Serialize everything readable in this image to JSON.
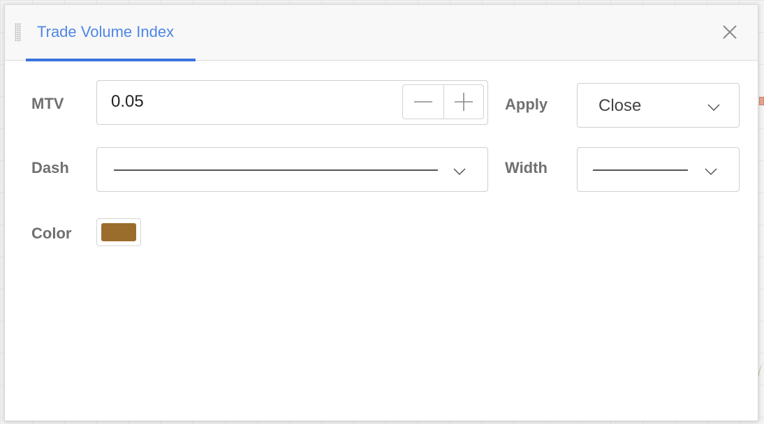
{
  "dialog": {
    "title": "Trade Volume Index",
    "accent_color": "#3b73de",
    "close_icon": "close-icon",
    "drag_icon": "drag-handle-icon"
  },
  "form": {
    "mtv": {
      "label": "MTV",
      "value": "0.05",
      "decrement_icon": "minus-icon",
      "increment_icon": "plus-icon"
    },
    "apply": {
      "label": "Apply",
      "selected": "Close"
    },
    "dash": {
      "label": "Dash",
      "selected_style": "solid"
    },
    "width": {
      "label": "Width",
      "selected_style": "solid"
    },
    "color": {
      "label": "Color",
      "value": "#9b6d2c"
    }
  }
}
